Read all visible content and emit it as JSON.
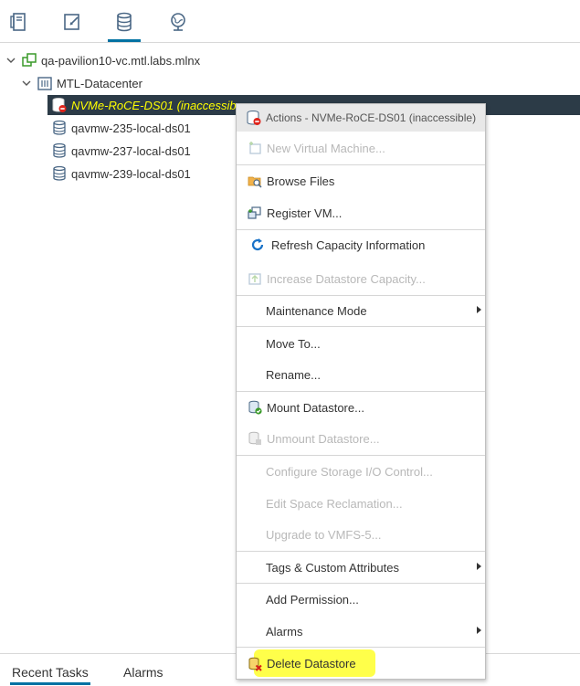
{
  "top_tabs": [
    {
      "name": "hosts-clusters",
      "active": false
    },
    {
      "name": "vms-templates",
      "active": false
    },
    {
      "name": "storage",
      "active": true
    },
    {
      "name": "networking",
      "active": false
    }
  ],
  "tree": {
    "vcenter": "qa-pavilion10-vc.mtl.labs.mlnx",
    "datacenter": "MTL-Datacenter",
    "datastores": [
      "NVMe-RoCE-DS01 (inaccessible)",
      "qavmw-235-local-ds01",
      "qavmw-237-local-ds01",
      "qavmw-239-local-ds01"
    ],
    "selected_visible_text": "NVMe-RoCE-DS01 (inaccessib"
  },
  "context_menu": {
    "header": "Actions - NVMe-RoCE-DS01 (inaccessible)",
    "items": {
      "new_vm": "New Virtual Machine...",
      "browse_files": "Browse Files",
      "register_vm": "Register VM...",
      "refresh_capacity": "Refresh Capacity Information",
      "increase_capacity": "Increase Datastore Capacity...",
      "maintenance_mode": "Maintenance Mode",
      "move_to": "Move To...",
      "rename": "Rename...",
      "mount": "Mount Datastore...",
      "unmount": "Unmount Datastore...",
      "configure_sioc": "Configure Storage I/O Control...",
      "edit_space_reclamation": "Edit Space Reclamation...",
      "upgrade_vmfs": "Upgrade to VMFS-5...",
      "tags_attributes": "Tags & Custom Attributes",
      "add_permission": "Add Permission...",
      "alarms": "Alarms",
      "delete_datastore": "Delete Datastore"
    }
  },
  "bottom_tabs": {
    "recent_tasks": "Recent Tasks",
    "alarms": "Alarms"
  },
  "colors": {
    "selected_row_bg": "#2c3b47",
    "selected_text": "#ffff00",
    "accent": "#0072a3",
    "highlight_marker": "#ffff2a"
  }
}
